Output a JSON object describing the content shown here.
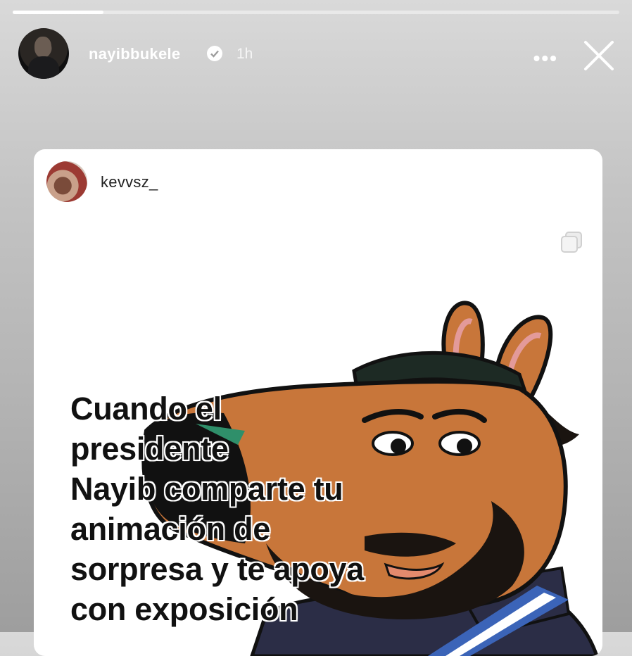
{
  "story": {
    "progress": 0.15
  },
  "header": {
    "username": "nayibbukele",
    "time": "1h",
    "more_icon": "more-horizontal-icon",
    "close_icon": "close-icon",
    "verified_icon": "verified-badge-icon"
  },
  "shared_post": {
    "username": "kevvsz_",
    "caption_lines": [
      "Cuando el",
      "presidente",
      "Nayib comparte tu",
      "animación de",
      "sorpresa y te apoya",
      "con exposición"
    ],
    "multi_icon": "copy-icon",
    "colors": {
      "horse_fur": "#c8763a",
      "beard": "#1a1410",
      "jacket": "#2b2d46",
      "sash_blue": "#3b64b8"
    }
  }
}
